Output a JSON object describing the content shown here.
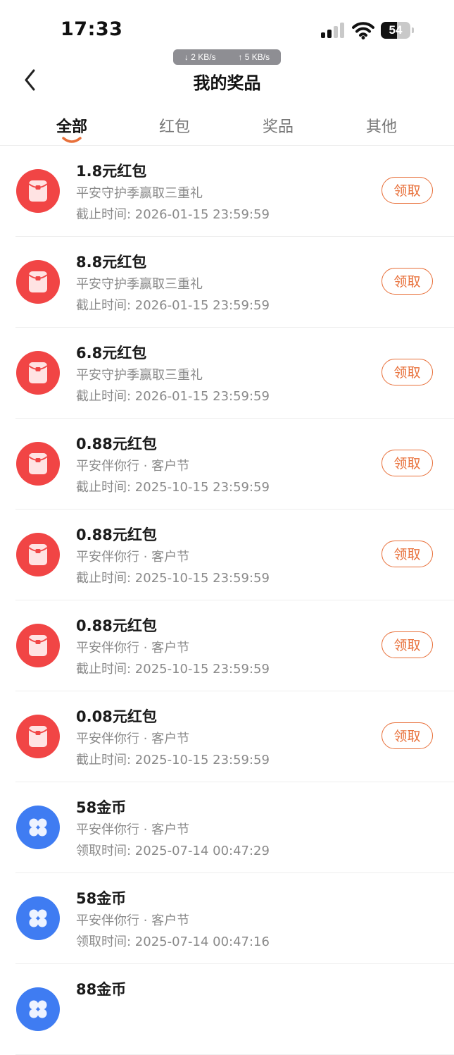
{
  "status_bar": {
    "time": "17:33",
    "battery": "54",
    "battery_level": 0.54,
    "net_down": "↓ 2 KB/s",
    "net_up": "↑ 5 KB/s"
  },
  "header": {
    "title": "我的奖品"
  },
  "tabs": [
    {
      "label": "全部",
      "active": true
    },
    {
      "label": "红包",
      "active": false
    },
    {
      "label": "奖品",
      "active": false
    },
    {
      "label": "其他",
      "active": false
    }
  ],
  "colors": {
    "accent": "#e8703a",
    "red_envelope": "#f14545",
    "coin_blue": "#3f7cf2"
  },
  "items": [
    {
      "title": "1.8元红包",
      "subtitle": "平安守护季赢取三重礼",
      "time": "截止时间: 2026-01-15 23:59:59",
      "icon": "red-envelope-icon",
      "action": "领取"
    },
    {
      "title": "8.8元红包",
      "subtitle": "平安守护季赢取三重礼",
      "time": "截止时间: 2026-01-15 23:59:59",
      "icon": "red-envelope-icon",
      "action": "领取"
    },
    {
      "title": "6.8元红包",
      "subtitle": "平安守护季赢取三重礼",
      "time": "截止时间: 2026-01-15 23:59:59",
      "icon": "red-envelope-icon",
      "action": "领取"
    },
    {
      "title": "0.88元红包",
      "subtitle": "平安伴你行 · 客户节",
      "time": "截止时间: 2025-10-15 23:59:59",
      "icon": "red-envelope-icon",
      "action": "领取"
    },
    {
      "title": "0.88元红包",
      "subtitle": "平安伴你行 · 客户节",
      "time": "截止时间: 2025-10-15 23:59:59",
      "icon": "red-envelope-icon",
      "action": "领取"
    },
    {
      "title": "0.88元红包",
      "subtitle": "平安伴你行 · 客户节",
      "time": "截止时间: 2025-10-15 23:59:59",
      "icon": "red-envelope-icon",
      "action": "领取"
    },
    {
      "title": "0.08元红包",
      "subtitle": "平安伴你行 · 客户节",
      "time": "截止时间: 2025-10-15 23:59:59",
      "icon": "red-envelope-icon",
      "action": "领取"
    },
    {
      "title": "58金币",
      "subtitle": "平安伴你行 · 客户节",
      "time": "领取时间: 2025-07-14 00:47:29",
      "icon": "coin-icon",
      "action": ""
    },
    {
      "title": "58金币",
      "subtitle": "平安伴你行 · 客户节",
      "time": "领取时间: 2025-07-14 00:47:16",
      "icon": "coin-icon",
      "action": ""
    },
    {
      "title": "88金币",
      "subtitle": "",
      "time": "",
      "icon": "coin-icon",
      "action": ""
    }
  ]
}
